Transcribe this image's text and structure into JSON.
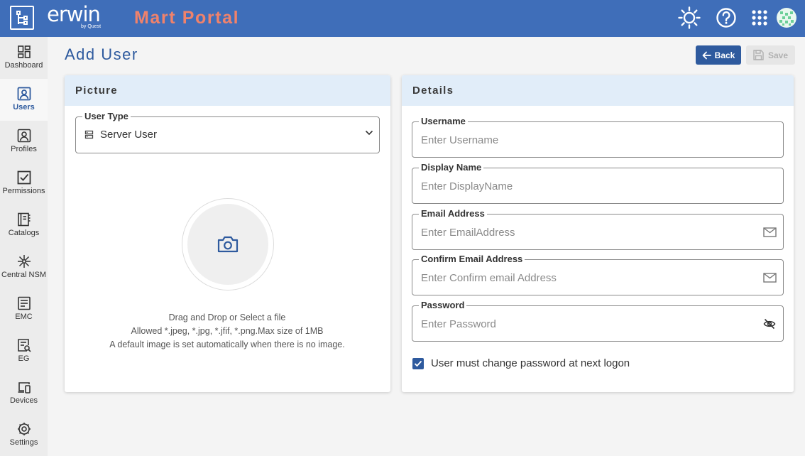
{
  "header": {
    "brand_name": "erwin",
    "brand_sub": "by Quest",
    "portal_title": "Mart Portal",
    "icons": [
      "theme-sun-icon",
      "help-icon",
      "apps-grid-icon",
      "user-avatar"
    ]
  },
  "sidebar": {
    "items": [
      {
        "label": "Dashboard",
        "icon": "dashboard-icon"
      },
      {
        "label": "Users",
        "icon": "users-icon",
        "active": true
      },
      {
        "label": "Profiles",
        "icon": "profiles-icon"
      },
      {
        "label": "Permissions",
        "icon": "permissions-icon"
      },
      {
        "label": "Catalogs",
        "icon": "catalogs-icon"
      },
      {
        "label": "Central NSM",
        "icon": "central-nsm-icon"
      },
      {
        "label": "EMC",
        "icon": "emc-icon"
      },
      {
        "label": "EG",
        "icon": "eg-icon"
      },
      {
        "label": "Devices",
        "icon": "devices-icon"
      },
      {
        "label": "Settings",
        "icon": "settings-icon"
      }
    ]
  },
  "page": {
    "title": "Add User",
    "back_label": "Back",
    "save_label": "Save"
  },
  "picture_card": {
    "title": "Picture",
    "user_type_label": "User Type",
    "user_type_value": "Server User",
    "upload_line1": "Drag and Drop or Select a file",
    "upload_line2": "Allowed *.jpeg, *.jpg, *.jfif, *.png.Max size of 1MB",
    "upload_line3": "A default image is set automatically when there is no image."
  },
  "details_card": {
    "title": "Details",
    "username": {
      "label": "Username",
      "placeholder": "Enter Username",
      "value": ""
    },
    "display_name": {
      "label": "Display Name",
      "placeholder": "Enter DisplayName",
      "value": ""
    },
    "email": {
      "label": "Email Address",
      "placeholder": "Enter EmailAddress",
      "value": ""
    },
    "confirm_email": {
      "label": "Confirm Email Address",
      "placeholder": "Enter Confirm email Address",
      "value": ""
    },
    "password": {
      "label": "Password",
      "placeholder": "Enter Password",
      "value": ""
    },
    "must_change_password": {
      "label": "User must change password at next logon",
      "checked": true
    }
  },
  "colors": {
    "header_bg": "#3f6eb9",
    "portal_title": "#f0826b",
    "accent": "#2e5a9e",
    "card_head_bg": "#e1edf9"
  }
}
